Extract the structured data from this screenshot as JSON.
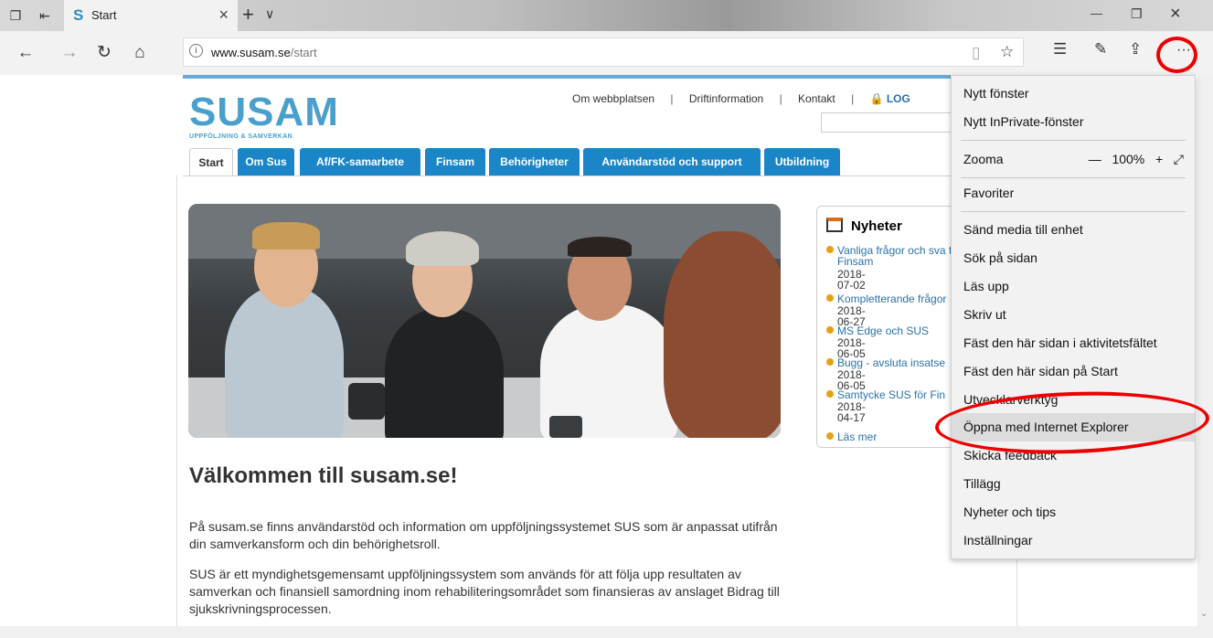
{
  "browser": {
    "tab_favicon": "S",
    "tab_title": "Start",
    "tab_close": "×",
    "new_tab": "+",
    "tab_dropdown": "∨",
    "win_min": "—",
    "win_restore": "❐",
    "win_close": "×",
    "url_host": "www.susam.se",
    "url_path": "/start",
    "more_button": "···"
  },
  "site": {
    "logo_text": "SUSAM",
    "logo_sub": "UPPFÖLJNING & SAMVERKAN",
    "top_links": [
      "Om webbplatsen",
      "|",
      "Driftinformation",
      "|",
      "Kontakt",
      "|"
    ],
    "login_label": "LOG",
    "tabs": [
      "Start",
      "Om Sus",
      "Af/FK-samarbete",
      "Finsam",
      "Behörigheter",
      "Användarstöd och support",
      "Utbildning"
    ],
    "news": {
      "header": "Nyheter",
      "items": [
        {
          "title": "Vanliga frågor och sva för Finsam",
          "date": "2018-07-02"
        },
        {
          "title": "Kompletterande frågor",
          "date": "2018-06-27"
        },
        {
          "title": "MS Edge och SUS",
          "date": "2018-06-05"
        },
        {
          "title": "Bugg - avsluta insatse",
          "date": "2018-06-05"
        },
        {
          "title": "Samtycke SUS för Fin",
          "date": "2018-04-17"
        }
      ],
      "more": "Läs mer"
    },
    "welcome": "Välkommen till susam.se!",
    "para1": "På susam.se finns användarstöd och information om uppföljningssystemet SUS som är anpassat utifrån din samverkansform och din behörighetsroll.",
    "para2": "SUS är ett myndighetsgemensamt uppföljningssystem som används för att följa upp resultaten av samverkan och finansiell samordning inom rehabiliteringsområdet som finansieras av anslaget Bidrag till sjukskrivningsprocessen."
  },
  "menu": {
    "items": [
      "Nytt fönster",
      "Nytt InPrivate-fönster",
      "Zooma",
      "Favoriter",
      "Sänd media till enhet",
      "Sök på sidan",
      "Läs upp",
      "Skriv ut",
      "Fäst den här sidan i aktivitetsfältet",
      "Fäst den här sidan på Start",
      "Utvecklarverktyg",
      "Öppna med Internet Explorer",
      "Skicka feedback",
      "Tillägg",
      "Nyheter och tips",
      "Inställningar"
    ],
    "zoom_minus": "—",
    "zoom_value": "100%",
    "zoom_plus": "+",
    "zoom_full": "⤢"
  },
  "colors": {
    "accent_tab": "#1a86c8",
    "highlight_ring": "#ee0000"
  }
}
